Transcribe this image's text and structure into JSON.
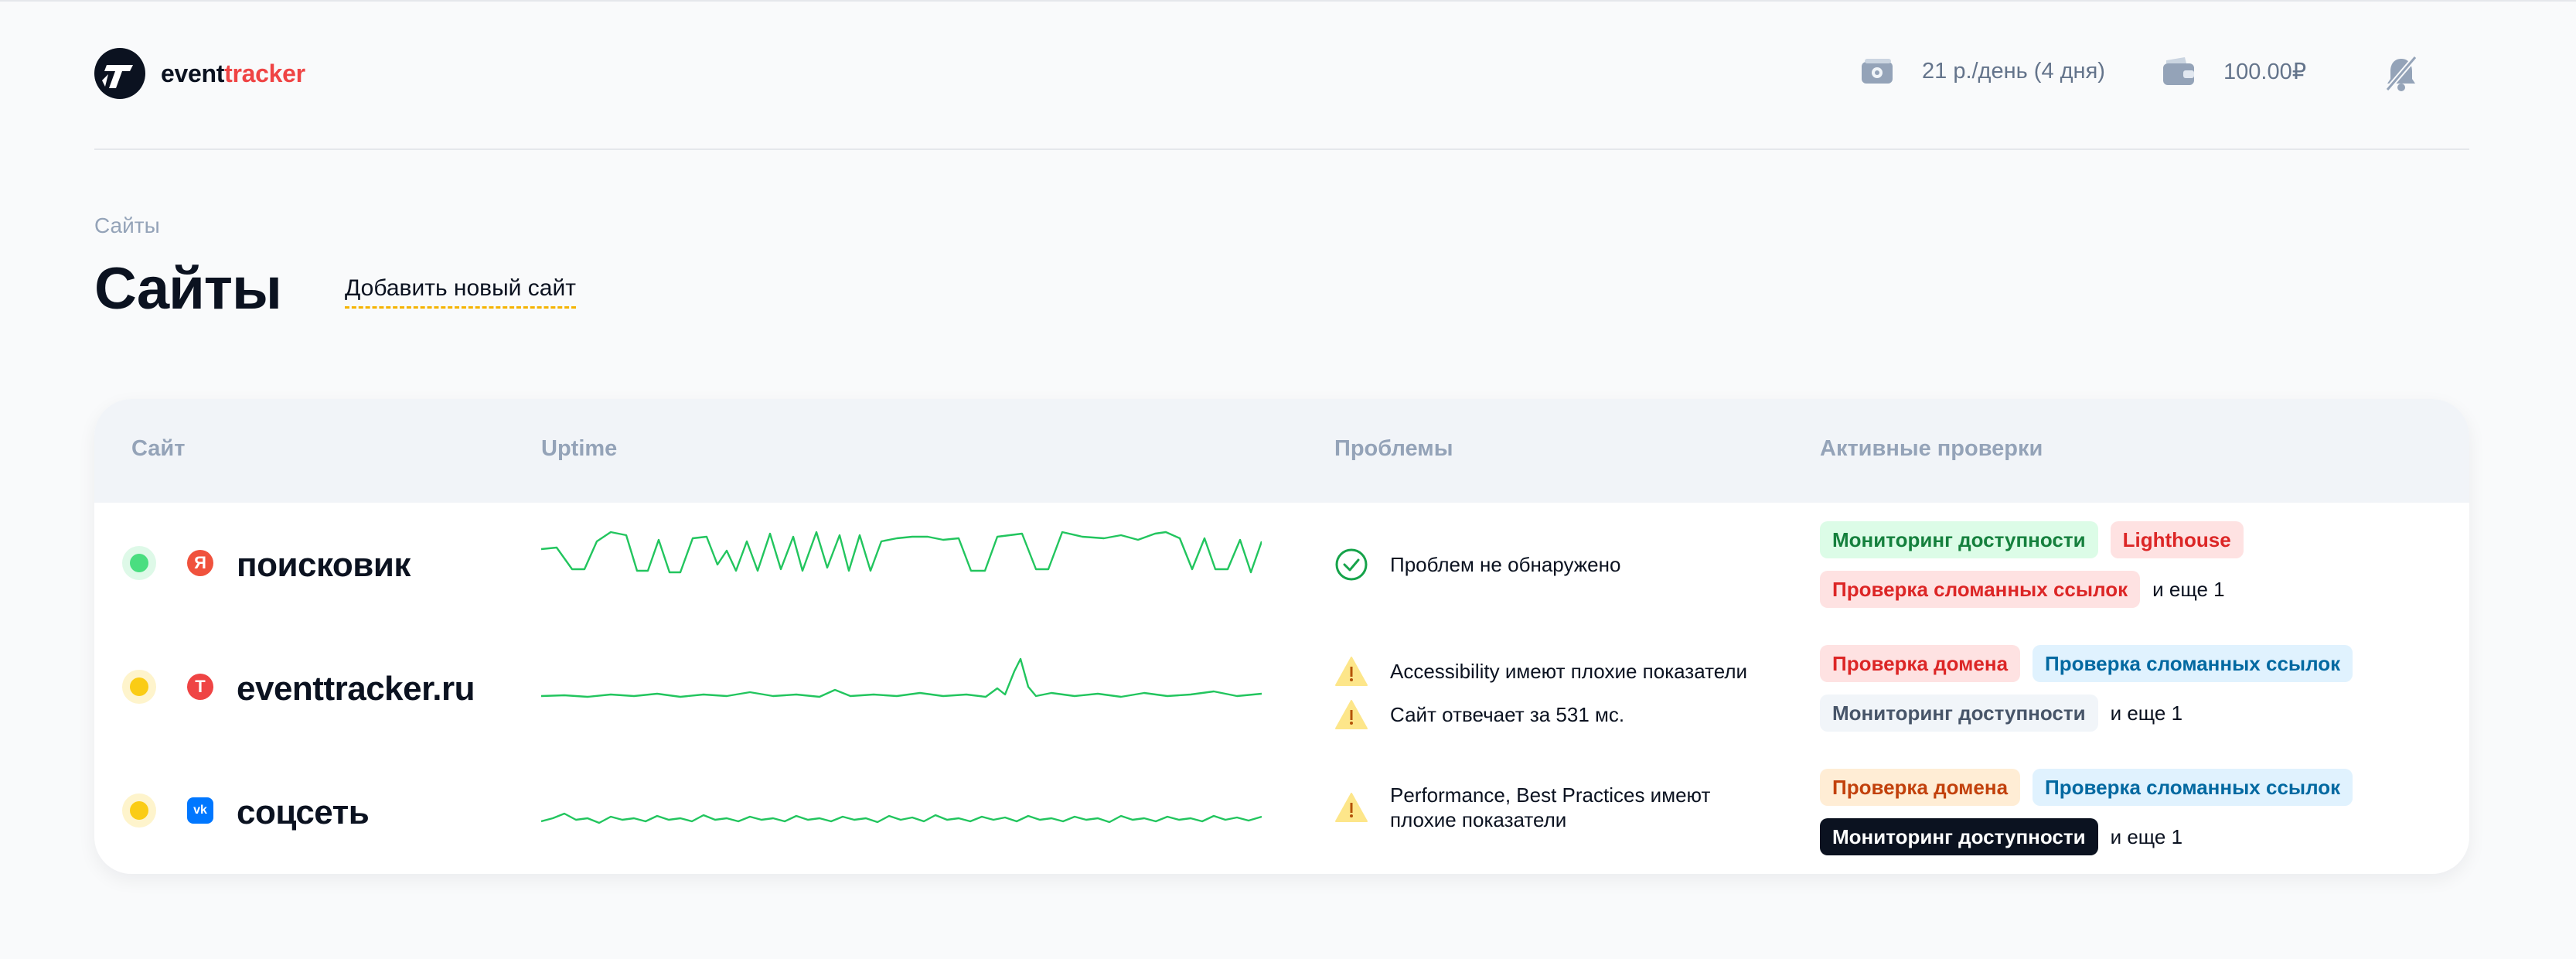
{
  "header": {
    "logo_part1": "event",
    "logo_part2": "tracker",
    "price_text": "21 р./день (4 дня)",
    "balance_text": "100.00₽"
  },
  "page": {
    "breadcrumb": "Сайты",
    "title": "Сайты",
    "add_link": "Добавить новый сайт"
  },
  "table": {
    "columns": [
      "Сайт",
      "Uptime",
      "Проблемы",
      "Активные проверки"
    ],
    "rows": [
      {
        "status": "green",
        "icon": "yandex-icon",
        "icon_letter": "Я",
        "name": "поисковик",
        "problems": [
          {
            "type": "ok",
            "text": "Проблем не обнаружено"
          }
        ],
        "tags": [
          {
            "label": "Мониторинг доступности",
            "color": "green"
          },
          {
            "label": "Lighthouse",
            "color": "red"
          },
          {
            "label": "Проверка сломанных ссылок",
            "color": "red"
          }
        ],
        "more": "и еще 1"
      },
      {
        "status": "yellow",
        "icon": "eventtracker-icon",
        "icon_letter": "T",
        "name": "eventtracker.ru",
        "problems": [
          {
            "type": "warning",
            "text": "Accessibility имеют плохие показатели"
          },
          {
            "type": "warning",
            "text": "Сайт отвечает за 531 мс."
          }
        ],
        "tags": [
          {
            "label": "Проверка домена",
            "color": "red"
          },
          {
            "label": "Проверка сломанных ссылок",
            "color": "blue"
          },
          {
            "label": "Мониторинг доступности",
            "color": "gray"
          }
        ],
        "more": "и еще 1"
      },
      {
        "status": "yellow",
        "icon": "vk-icon",
        "icon_letter": "vk",
        "name": "соцсеть",
        "problems": [
          {
            "type": "warning",
            "text_line1": "Performance, Best Practices имеют",
            "text_line2": "плохие показатели"
          }
        ],
        "tags": [
          {
            "label": "Проверка домена",
            "color": "orange"
          },
          {
            "label": "Проверка сломанных ссылок",
            "color": "blue"
          },
          {
            "label": "Мониторинг доступности",
            "color": "dark"
          }
        ],
        "more": "и еще 1"
      }
    ]
  },
  "colors": {
    "accent": "#ef4444",
    "uptime_line": "#22c55e",
    "link_underline": "#f5b301"
  }
}
